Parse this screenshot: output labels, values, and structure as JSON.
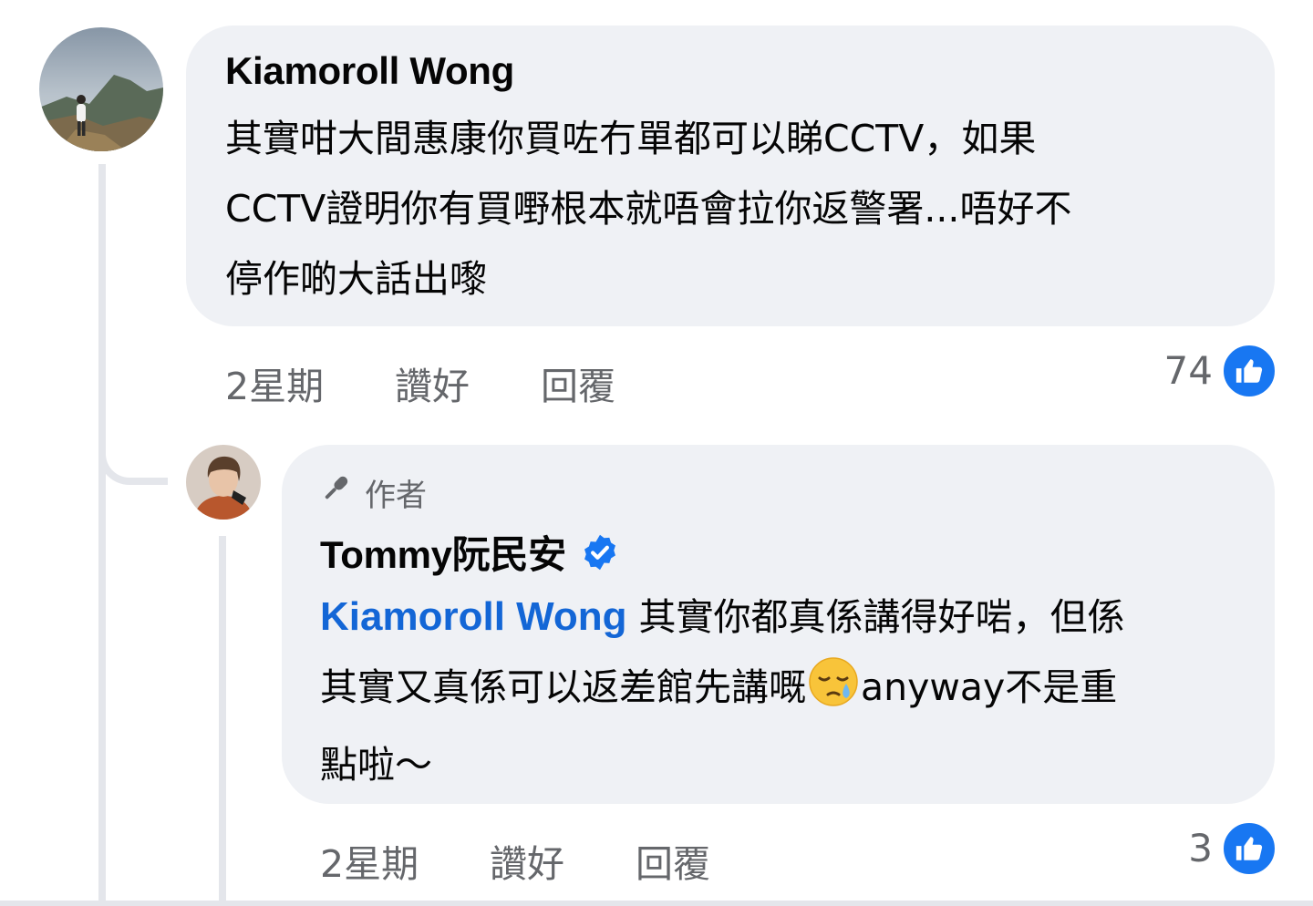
{
  "comment": {
    "author": "Kiamoroll Wong",
    "lines": [
      "其實咁大間惠康你買咗冇單都可以睇CCTV，如果",
      "CCTV證明你有買嘢根本就唔會拉你返警署...唔好不",
      "停作啲大話出嚟"
    ],
    "time": "2星期",
    "like_label": "讚好",
    "reply_label": "回覆",
    "reactions": "74"
  },
  "reply": {
    "badge": "作者",
    "author": "Tommy阮民安",
    "mention": "Kiamoroll Wong",
    "line1_rest": " 其實你都真係講得好啱，但係",
    "line2_pre": "其實又真係可以返差館先講嘅",
    "line2_post": "anyway不是重",
    "line3": "點啦～",
    "time": "2星期",
    "like_label": "讚好",
    "reply_label": "回覆",
    "reactions": "3"
  },
  "colors": {
    "like_blue": "#1877f2",
    "verified_blue": "#1877f2",
    "mention": "#1366d6",
    "bubble": "#eff1f5"
  }
}
